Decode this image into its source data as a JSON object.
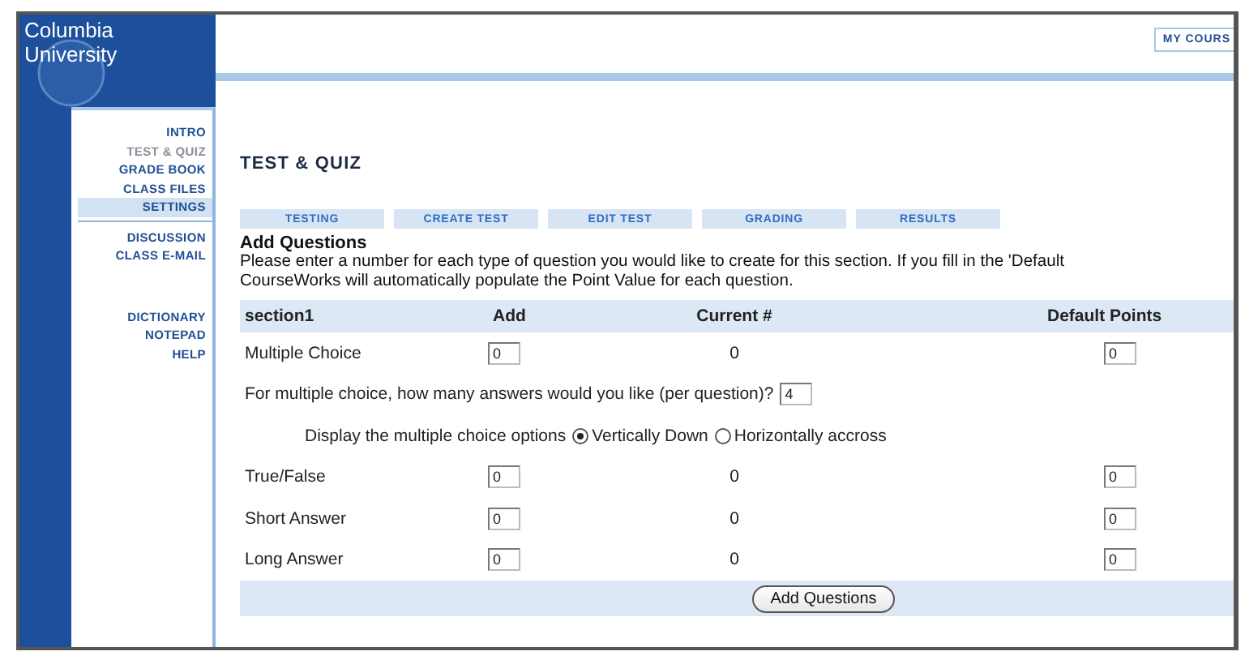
{
  "logo": {
    "lines": [
      "Columbia",
      "University"
    ]
  },
  "header": {
    "button": "MY COURS"
  },
  "sidebar": {
    "groups": [
      {
        "items": [
          {
            "label": "INTRO",
            "selected": false,
            "dimmed": false
          },
          {
            "label": "TEST & QUIZ",
            "selected": false,
            "dimmed": true
          },
          {
            "label": "GRADE BOOK",
            "selected": false,
            "dimmed": false
          },
          {
            "label": "CLASS FILES",
            "selected": false,
            "dimmed": false
          },
          {
            "label": "SETTINGS",
            "selected": true,
            "dimmed": false
          }
        ]
      },
      {
        "items": [
          {
            "label": "DISCUSSION",
            "selected": false,
            "dimmed": false
          },
          {
            "label": "CLASS E-MAIL",
            "selected": false,
            "dimmed": false
          }
        ]
      },
      {
        "items": [
          {
            "label": "DICTIONARY",
            "selected": false,
            "dimmed": false
          },
          {
            "label": "NOTEPAD",
            "selected": false,
            "dimmed": false
          },
          {
            "label": "HELP",
            "selected": false,
            "dimmed": false
          }
        ]
      }
    ]
  },
  "page_title": "TEST & QUIZ",
  "tabs": [
    {
      "label": "TESTING"
    },
    {
      "label": "CREATE TEST"
    },
    {
      "label": "EDIT TEST"
    },
    {
      "label": "GRADING"
    },
    {
      "label": "RESULTS"
    }
  ],
  "section_heading": "Add Questions",
  "instructions": [
    "Please enter a number for each type of question you would like to create for this section. If you fill in the 'Default",
    "CourseWorks will automatically populate the Point Value for each question."
  ],
  "table": {
    "columns": [
      "section1",
      "Add",
      "Current #",
      "Default Points"
    ],
    "rows": [
      {
        "kind": "question",
        "label": "Multiple Choice",
        "add": "0",
        "current": "0",
        "points": "0"
      },
      {
        "kind": "prompt",
        "label": "For multiple choice, how many answers would you like (per question)?",
        "value": "4"
      },
      {
        "kind": "options",
        "label": "Display the multiple choice options",
        "options": [
          {
            "label": "Vertically Down",
            "selected": true
          },
          {
            "label": "Horizontally accross",
            "selected": false
          }
        ]
      },
      {
        "kind": "question",
        "label": "True/False",
        "add": "0",
        "current": "0",
        "points": "0"
      },
      {
        "kind": "question",
        "label": "Short Answer",
        "add": "0",
        "current": "0",
        "points": "0"
      },
      {
        "kind": "question",
        "label": "Long Answer",
        "add": "0",
        "current": "0",
        "points": "0"
      }
    ]
  },
  "submit": "Add Questions"
}
